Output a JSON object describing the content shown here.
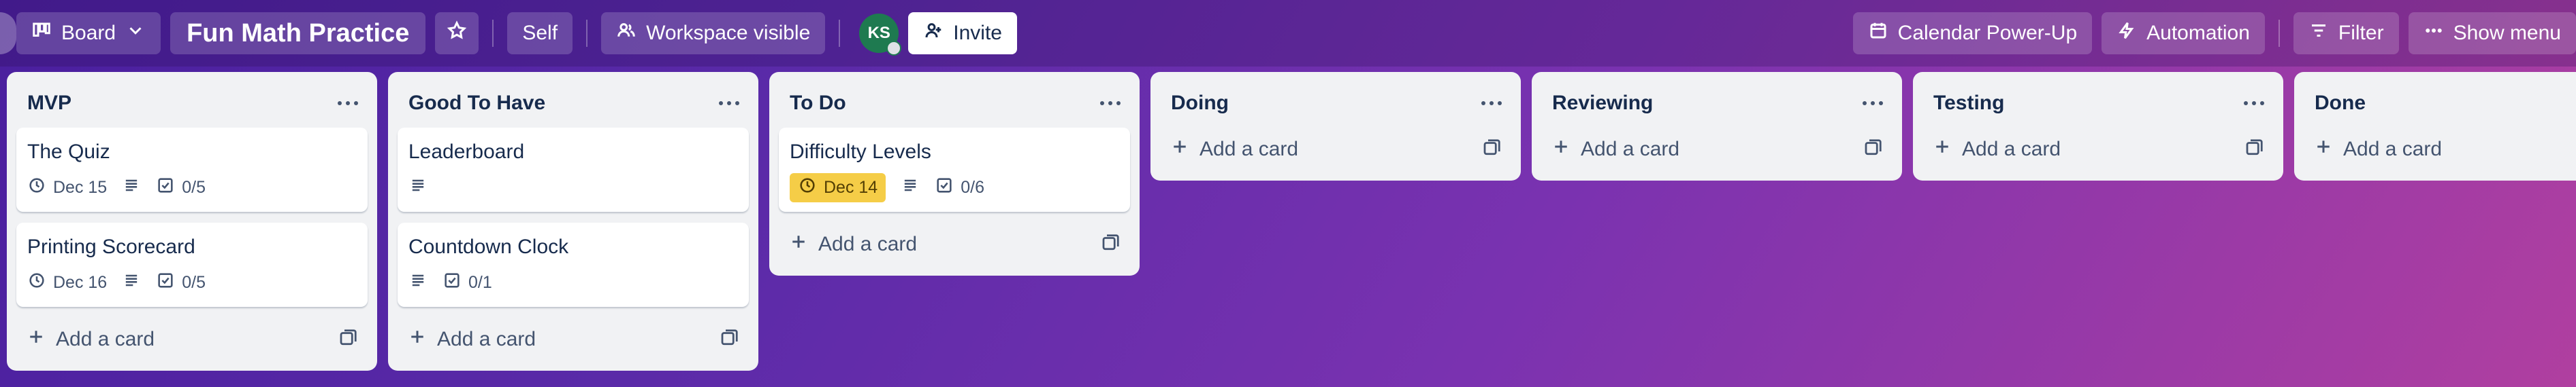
{
  "header": {
    "board_view_label": "Board",
    "board_title": "Fun Math Practice",
    "visibility_self": "Self",
    "workspace_visible": "Workspace visible",
    "avatar_initials": "KS",
    "invite_label": "Invite",
    "calendar_label": "Calendar Power-Up",
    "automation_label": "Automation",
    "filter_label": "Filter",
    "show_menu_label": "Show menu"
  },
  "lists": [
    {
      "title": "MVP",
      "add_label": "Add a card",
      "cards": [
        {
          "title": "The Quiz",
          "due": "Dec 15",
          "checklist": "0/5"
        },
        {
          "title": "Printing Scorecard",
          "due": "Dec 16",
          "checklist": "0/5"
        }
      ]
    },
    {
      "title": "Good To Have",
      "add_label": "Add a card",
      "cards": [
        {
          "title": "Leaderboard"
        },
        {
          "title": "Countdown Clock",
          "checklist": "0/1"
        }
      ]
    },
    {
      "title": "To Do",
      "add_label": "Add a card",
      "cards": [
        {
          "title": "Difficulty Levels",
          "due": "Dec 14",
          "checklist": "0/6"
        }
      ]
    },
    {
      "title": "Doing",
      "add_label": "Add a card"
    },
    {
      "title": "Reviewing",
      "add_label": "Add a card"
    },
    {
      "title": "Testing",
      "add_label": "Add a card"
    },
    {
      "title": "Done",
      "add_label": "Add a card"
    }
  ],
  "colors": {
    "due_soon": "#f5cd47",
    "avatar": "#1e7a50"
  },
  "icons": {
    "board_view": "board-icon",
    "star": "star-icon",
    "workspace": "people-icon",
    "invite": "person-add-icon",
    "calendar": "calendar-icon",
    "automation": "lightning-icon",
    "filter": "filter-icon",
    "menu": "ellipsis-icon",
    "due": "clock-icon",
    "description": "description-icon",
    "checklist": "checklist-icon",
    "add": "plus-icon",
    "template": "template-icon"
  }
}
